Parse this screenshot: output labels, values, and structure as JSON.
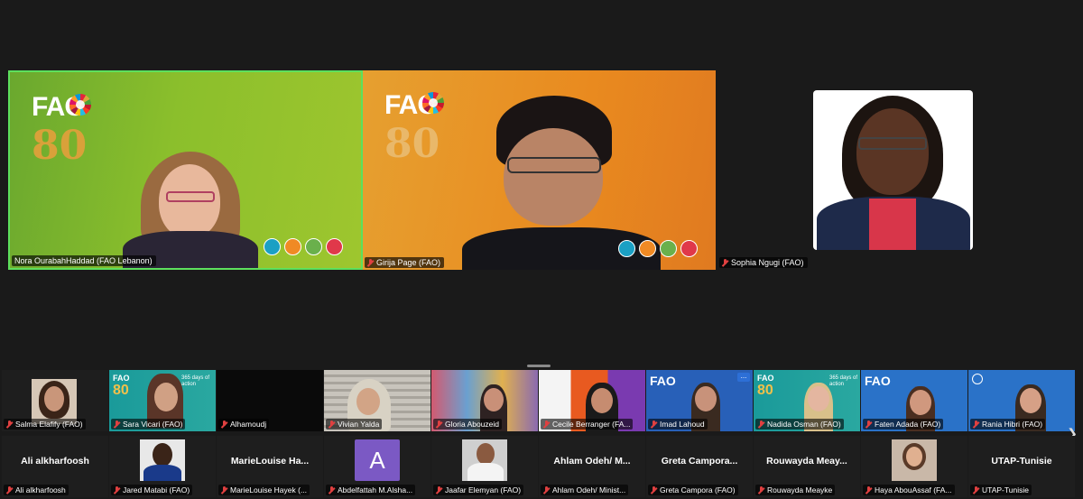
{
  "main_tiles": {
    "speaker1": {
      "name": "Nora OurabahHaddad (FAO Lebanon)",
      "muted": false,
      "logo_text": "FAO",
      "logo_number": "80"
    },
    "speaker2": {
      "name": "Girija Page (FAO)",
      "muted": true,
      "logo_text": "FAO",
      "logo_number": "80"
    },
    "speaker3": {
      "name": "Sophia Ngugi (FAO)",
      "muted": true
    }
  },
  "gallery": {
    "row1": [
      {
        "name": "Salma Elafify (FAO)"
      },
      {
        "name": "Sara Vicari (FAO)"
      },
      {
        "name": "Alhamoudj"
      },
      {
        "name": "Vivian Yalda"
      },
      {
        "name": "Gloria Abouzeid"
      },
      {
        "name": "Cecile Berranger (FA..."
      },
      {
        "name": "Imad Lahoud"
      },
      {
        "name": "Nadida Osman (FAO)"
      },
      {
        "name": "Faten Adada (FAO)"
      },
      {
        "name": "Rania Hibri (FAO)"
      }
    ],
    "row2": [
      {
        "display": "Ali alkharfoosh",
        "name": "Ali alkharfoosh"
      },
      {
        "display": "",
        "name": "Jared Matabi (FAO)"
      },
      {
        "display": "MarieLouise  Ha...",
        "name": "MarieLouise Hayek (..."
      },
      {
        "display": "",
        "avatar": "A",
        "name": "Abdelfattah M.Alsha..."
      },
      {
        "display": "",
        "name": "Jaafar Elemyan (FAO)"
      },
      {
        "display": "Ahlam  Odeh/  M...",
        "name": "Ahlam Odeh/ Minist..."
      },
      {
        "display": "Greta  Campora...",
        "name": "Greta Campora (FAO)"
      },
      {
        "display": "Rouwayda  Meay...",
        "name": "Rouwayda Meayke"
      },
      {
        "display": "",
        "name": "Haya AbouAssaf (FA..."
      },
      {
        "display": "UTAP-Tunisie",
        "name": "UTAP-Tunisie"
      }
    ],
    "overlay_texts": {
      "days_of_action": "365 days of action",
      "more": "..."
    }
  },
  "colors": {
    "active_speaker_border": "#5de05d",
    "muted_mic": "#e04040",
    "avatar_purple": "#7b59c4"
  }
}
